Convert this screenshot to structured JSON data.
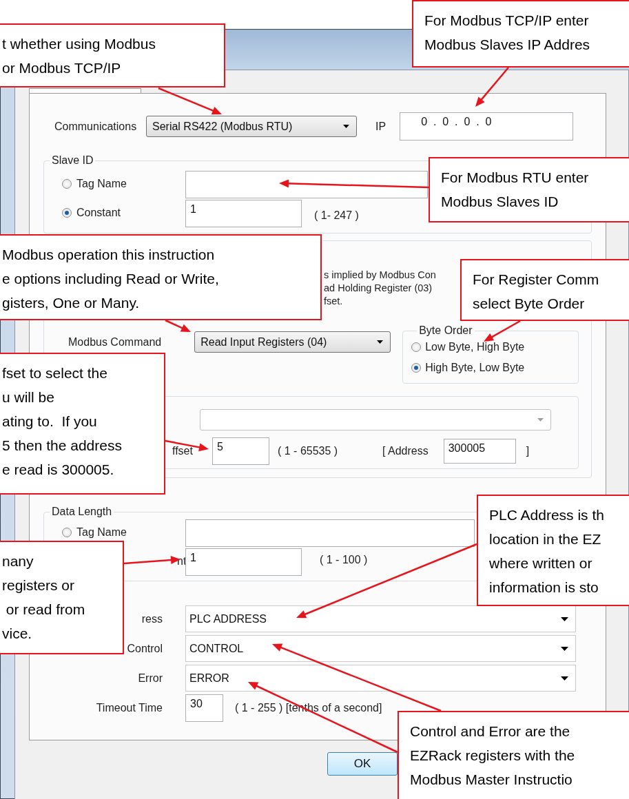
{
  "communications": {
    "label": "Communications",
    "value": "Serial RS422 (Modbus RTU)",
    "ip_label": "IP",
    "ip_value": "0  .  0  .  0  .  0"
  },
  "slave_id": {
    "legend": "Slave ID",
    "options": [
      {
        "label": "Tag Name",
        "selected": false
      },
      {
        "label": "Constant",
        "selected": true
      }
    ],
    "constant_value": "1",
    "range": "( 1- 247 )"
  },
  "modbus": {
    "description": "s implied by Modbus Con\nad Holding Register (03)\nfset.",
    "command_label": "Modbus Command",
    "command_value": "Read Input Registers (04)",
    "byte_order": {
      "legend": "Byte Order",
      "options": [
        {
          "label": "Low Byte, High Byte",
          "selected": false
        },
        {
          "label": "High Byte, Low Byte",
          "selected": true
        }
      ]
    }
  },
  "offset": {
    "label": "ffset",
    "value": "5",
    "range": "( 1 - 65535 )",
    "address_label": "[ Address",
    "address_value": "300005",
    "address_close": "]"
  },
  "data_length": {
    "legend": "Data Length",
    "options": [
      {
        "label": "Tag Name",
        "selected": false
      }
    ],
    "constant_label": "nt",
    "constant_value": "1",
    "range": "( 1 - 100 )"
  },
  "registers": [
    {
      "label": "ress",
      "value": "PLC ADDRESS"
    },
    {
      "label": "Control",
      "value": "CONTROL"
    },
    {
      "label": "Error",
      "value": "ERROR"
    }
  ],
  "timeout": {
    "label": "Timeout Time",
    "value": "30",
    "range": "( 1 - 255 ) [tenths of a second]"
  },
  "buttons": [
    "OK"
  ],
  "callouts": [
    {
      "text": "t whether using Modbus\nor Modbus TCP/IP"
    },
    {
      "text": "For Modbus TCP/IP enter\nModbus Slaves IP Addres"
    },
    {
      "text": "For Modbus RTU enter\nModbus Slaves ID"
    },
    {
      "text": "Modbus operation this instruction\ne options including Read or Write,\ngisters, One or Many."
    },
    {
      "text": "For Register Comm\nselect Byte Order"
    },
    {
      "text": "fset to select the\nu will be\nating to.  If you\n5 then the address\ne read is 300005."
    },
    {
      "text": "PLC Address is th\nlocation in the EZ\nwhere written or\ninformation is sto"
    },
    {
      "text": "nany\nregisters or\n or read from\nvice."
    },
    {
      "text": "Control and Error are the\nEZRack registers with the\nModbus Master Instructio"
    }
  ]
}
